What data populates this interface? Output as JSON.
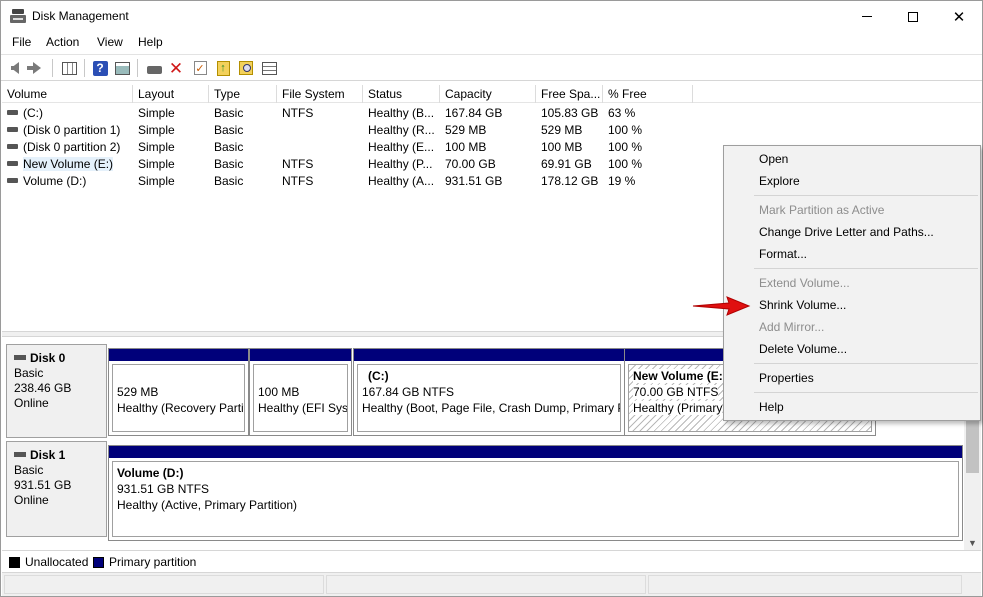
{
  "window": {
    "title": "Disk Management"
  },
  "menu": [
    "File",
    "Action",
    "View",
    "Help"
  ],
  "volume_list": {
    "columns": [
      "Volume",
      "Layout",
      "Type",
      "File System",
      "Status",
      "Capacity",
      "Free Spa...",
      "% Free"
    ],
    "rows": [
      [
        "(C:)",
        "Simple",
        "Basic",
        "NTFS",
        "Healthy (B...",
        "167.84 GB",
        "105.83 GB",
        "63 %"
      ],
      [
        "(Disk 0 partition 1)",
        "Simple",
        "Basic",
        "",
        "Healthy (R...",
        "529 MB",
        "529 MB",
        "100 %"
      ],
      [
        "(Disk 0 partition 2)",
        "Simple",
        "Basic",
        "",
        "Healthy (E...",
        "100 MB",
        "100 MB",
        "100 %"
      ],
      [
        "New Volume (E:)",
        "Simple",
        "Basic",
        "NTFS",
        "Healthy (P...",
        "70.00 GB",
        "69.91 GB",
        "100 %"
      ],
      [
        "Volume (D:)",
        "Simple",
        "Basic",
        "NTFS",
        "Healthy (A...",
        "931.51 GB",
        "178.12 GB",
        "19 %"
      ]
    ],
    "selected_row": 3
  },
  "disks": [
    {
      "name": "Disk 0",
      "type": "Basic",
      "size": "238.46 GB",
      "state": "Online",
      "partitions": [
        {
          "title": "",
          "size": "529 MB",
          "status": "Healthy (Recovery Partit"
        },
        {
          "title": "",
          "size": "100 MB",
          "status": "Healthy (EFI Syst"
        },
        {
          "title": "(C:)",
          "size": "167.84 GB NTFS",
          "status": "Healthy (Boot, Page File, Crash Dump, Primary P"
        },
        {
          "title": "New Volume  (E:",
          "size": "70.00 GB NTFS",
          "status": "Healthy (Primary"
        }
      ]
    },
    {
      "name": "Disk 1",
      "type": "Basic",
      "size": "931.51 GB",
      "state": "Online",
      "partitions": [
        {
          "title": "Volume  (D:)",
          "size": "931.51 GB NTFS",
          "status": "Healthy (Active, Primary Partition)"
        }
      ]
    }
  ],
  "legend": {
    "items": [
      {
        "label": "Unallocated",
        "color": "#000000"
      },
      {
        "label": "Primary partition",
        "color": "#00007a"
      }
    ]
  },
  "context_menu": {
    "items": [
      {
        "label": "Open",
        "disabled": false
      },
      {
        "label": "Explore",
        "disabled": false
      },
      {
        "label": "Mark Partition as Active",
        "disabled": true
      },
      {
        "label": "Change Drive Letter and Paths...",
        "disabled": false
      },
      {
        "label": "Format...",
        "disabled": false
      },
      {
        "label": "Extend Volume...",
        "disabled": true
      },
      {
        "label": "Shrink Volume...",
        "disabled": false
      },
      {
        "label": "Add Mirror...",
        "disabled": true
      },
      {
        "label": "Delete Volume...",
        "disabled": false
      },
      {
        "label": "Properties",
        "disabled": false
      },
      {
        "label": "Help",
        "disabled": false
      }
    ]
  },
  "colors": {
    "primary_partition": "#00007a",
    "annotation_arrow": "#e01010"
  },
  "icons": {
    "toolbar": [
      "back-arrow-icon",
      "forward-arrow-icon",
      "console-tree-icon",
      "help-icon",
      "properties-panel-icon",
      "drive-icon",
      "delete-icon",
      "check-icon",
      "folder-up-icon",
      "search-icon",
      "list-properties-icon"
    ]
  }
}
